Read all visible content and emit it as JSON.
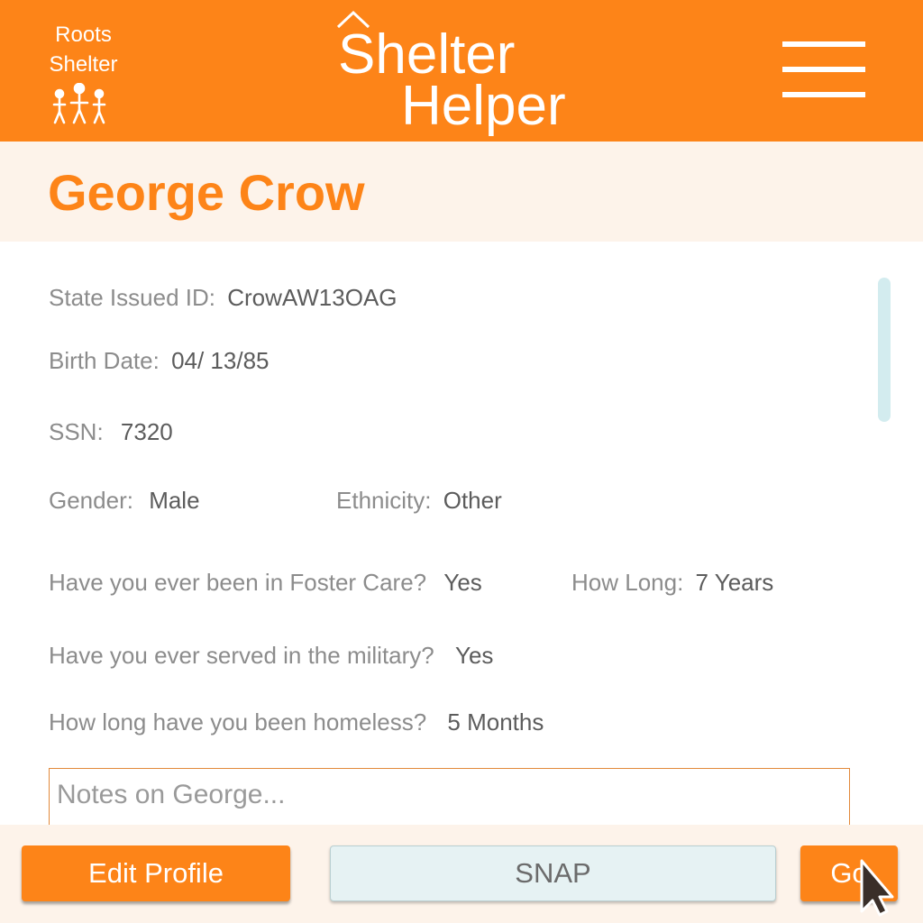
{
  "header": {
    "logo": {
      "line1": "Roots",
      "line2": "Shelter"
    },
    "title_line1": "Shelter",
    "title_line2": "Helper",
    "menu_icon": "hamburger-menu-icon"
  },
  "profile": {
    "name": "George Crow",
    "fields": {
      "state_id": {
        "label": "State Issued ID:",
        "value": "CrowAW13OAG"
      },
      "birth_date": {
        "label": "Birth Date:",
        "value": "04/ 13/85"
      },
      "ssn": {
        "label": "SSN:",
        "value": "7320"
      },
      "gender": {
        "label": "Gender:",
        "value": "Male"
      },
      "ethnicity": {
        "label": "Ethnicity:",
        "value": "Other"
      },
      "foster_care": {
        "label": "Have you ever been in Foster Care?",
        "value": "Yes"
      },
      "foster_duration": {
        "label": "How Long:",
        "value": "7 Years"
      },
      "military": {
        "label": "Have you ever served in the military?",
        "value": "Yes"
      },
      "homeless_duration": {
        "label": "How long have you been homeless?",
        "value": "5 Months"
      }
    },
    "notes": {
      "placeholder": "Notes on George...",
      "value": ""
    }
  },
  "footer": {
    "edit_label": "Edit Profile",
    "snap_label": "SNAP",
    "go_label": "Go"
  },
  "colors": {
    "brand": "#fd8418",
    "band": "#fdf3ea",
    "label": "#8c8c8c",
    "value": "#5c5c5c",
    "snap_bg": "#e6f2f3",
    "scrollbar": "#d3ecef"
  }
}
